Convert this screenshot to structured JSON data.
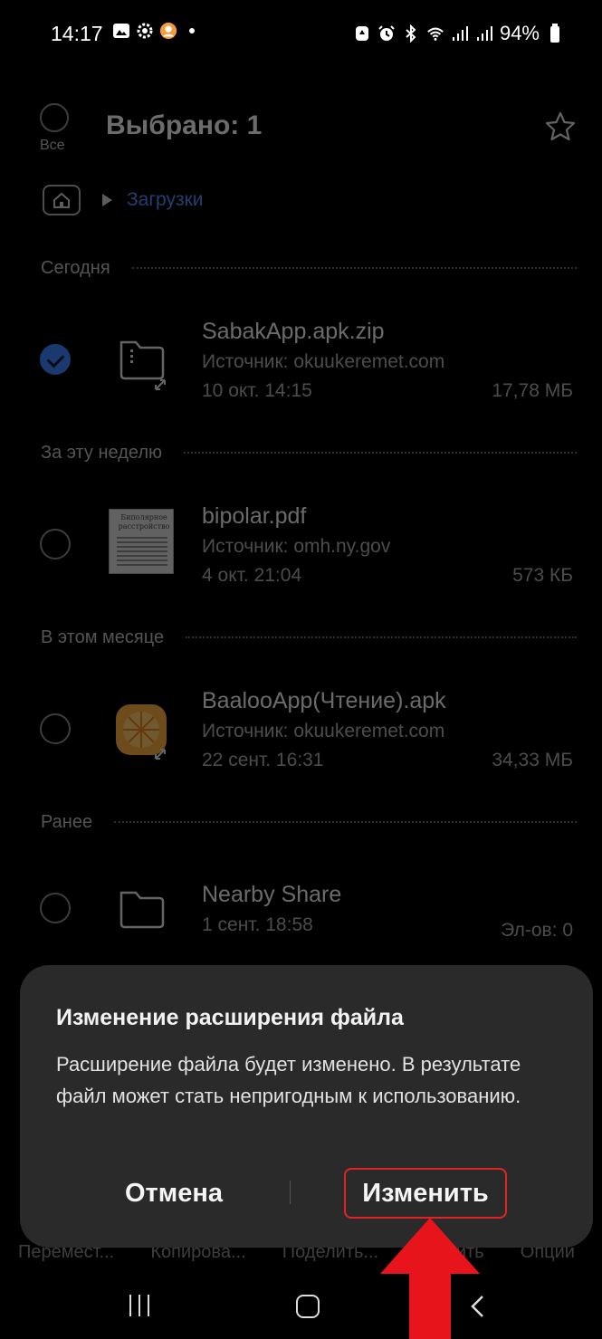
{
  "status_bar": {
    "time": "14:17",
    "battery": "94%",
    "left_icons": [
      "gallery-icon",
      "settings-icon",
      "avatar-icon",
      "dot-icon"
    ],
    "right_icons": [
      "battery-saver-icon",
      "alarm-icon",
      "bluetooth-icon",
      "wifi-icon",
      "signal-icon",
      "signal-icon",
      "battery-icon"
    ]
  },
  "header": {
    "select_all_label": "Все",
    "title": "Выбрано: 1"
  },
  "breadcrumb": {
    "folder": "Загрузки"
  },
  "sections": [
    {
      "label": "Сегодня"
    },
    {
      "label": "За эту неделю"
    },
    {
      "label": "В этом месяце"
    },
    {
      "label": "Ранее"
    }
  ],
  "files": [
    {
      "name": "SabakApp.apk.zip",
      "source": "Источник: okuukeremet.com",
      "date": "10 окт. 14:15",
      "size": "17,78 МБ",
      "checked": true,
      "icon": "zip-file-icon"
    },
    {
      "name": "bipolar.pdf",
      "source": "Источник: omh.ny.gov",
      "date": "4 окт. 21:04",
      "size": "573 КБ",
      "checked": false,
      "icon": "pdf-thumbnail",
      "thumb_title": "Биполярное расстройство"
    },
    {
      "name": "BaalooApp(Чтение).apk",
      "source": "Источник: okuukeremet.com",
      "date": "22 сент. 16:31",
      "size": "34,33 МБ",
      "checked": false,
      "icon": "app-icon"
    },
    {
      "name": "Nearby Share",
      "source": "",
      "date": "1 сент. 18:58",
      "size": "Эл-ов: 0",
      "checked": false,
      "icon": "folder-icon"
    }
  ],
  "bottom_actions": [
    "Перемест...",
    "Копирова...",
    "Поделить...",
    "Удалить",
    "Опции"
  ],
  "dialog": {
    "title": "Изменение расширения файла",
    "body": "Расширение файла будет изменено. В результате файл может стать непригодным к использованию.",
    "cancel_label": "Отмена",
    "confirm_label": "Изменить"
  },
  "colors": {
    "accent": "#4f8df6",
    "check": "#3b82f6",
    "dialog_bg": "#2a2a2a",
    "highlight": "#e02424"
  }
}
